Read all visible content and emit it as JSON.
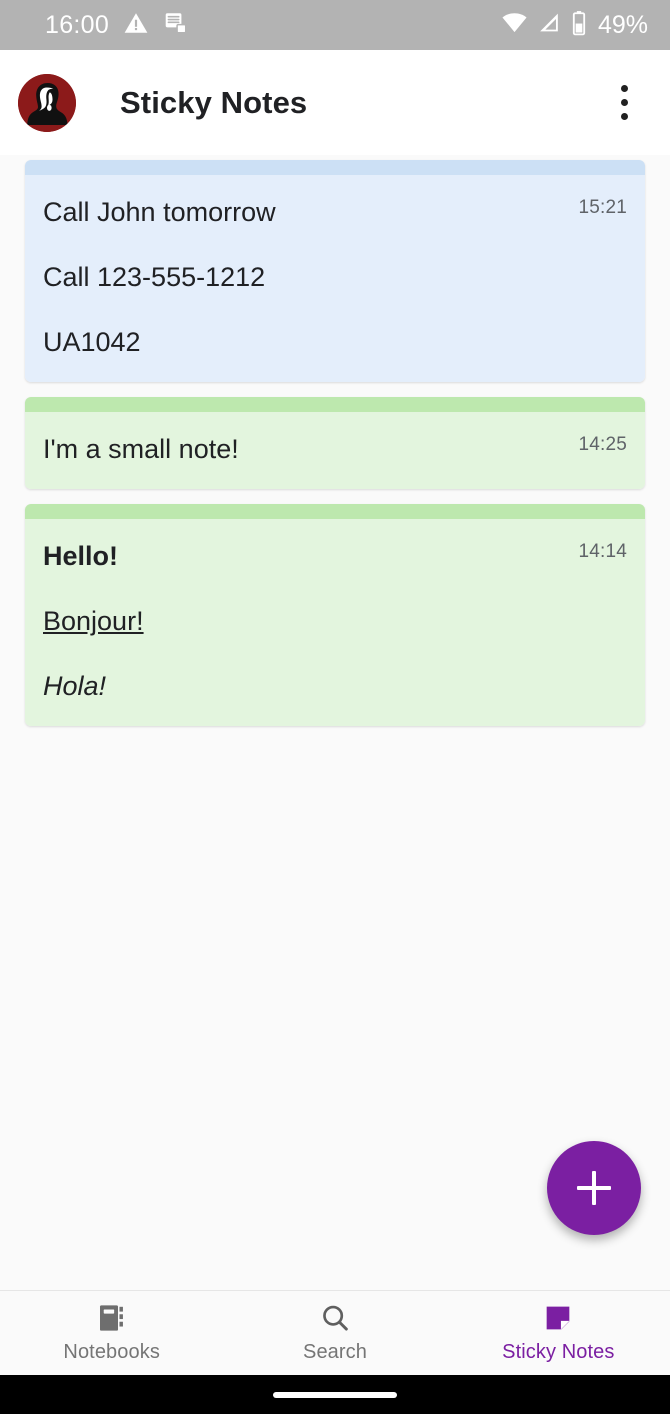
{
  "status_bar": {
    "clock": "16:00",
    "battery_percent": "49%",
    "icons": [
      "warning-triangle-icon",
      "notes-stack-icon",
      "wifi-icon",
      "cellular-signal-icon",
      "battery-icon"
    ],
    "background_color": "#b3b3b3"
  },
  "app_bar": {
    "title": "Sticky Notes",
    "avatar_name": "user-avatar",
    "avatar_background": "#8c1a1a",
    "overflow_menu_name": "more-options-icon"
  },
  "notes": [
    {
      "id": "note-call-john",
      "time": "15:21",
      "strip_color": "#cce0f5",
      "body_color": "#e4eefb",
      "lines": [
        {
          "text": "Call John tomorrow",
          "style": "normal"
        },
        {
          "text": "Call 123-555-1212",
          "style": "normal"
        },
        {
          "text": "UA1042",
          "style": "normal"
        }
      ]
    },
    {
      "id": "note-small",
      "time": "14:25",
      "strip_color": "#bde8ae",
      "body_color": "#e3f5de",
      "lines": [
        {
          "text": "I'm a small note!",
          "style": "normal"
        }
      ]
    },
    {
      "id": "note-greetings",
      "time": "14:14",
      "strip_color": "#bde8ae",
      "body_color": "#e3f5de",
      "lines": [
        {
          "text": "Hello!",
          "style": "bold"
        },
        {
          "text": "Bonjour!",
          "style": "underline"
        },
        {
          "text": "Hola!",
          "style": "italic"
        }
      ]
    }
  ],
  "fab": {
    "label": "+",
    "name": "add-note-button",
    "color": "#7b1fa2"
  },
  "bottom_nav": {
    "active_color": "#7b1fa2",
    "inactive_color": "#757575",
    "items": [
      {
        "label": "Notebooks",
        "icon": "notebook-icon",
        "active": false
      },
      {
        "label": "Search",
        "icon": "search-icon",
        "active": false
      },
      {
        "label": "Sticky Notes",
        "icon": "sticky-note-icon",
        "active": true
      }
    ]
  }
}
